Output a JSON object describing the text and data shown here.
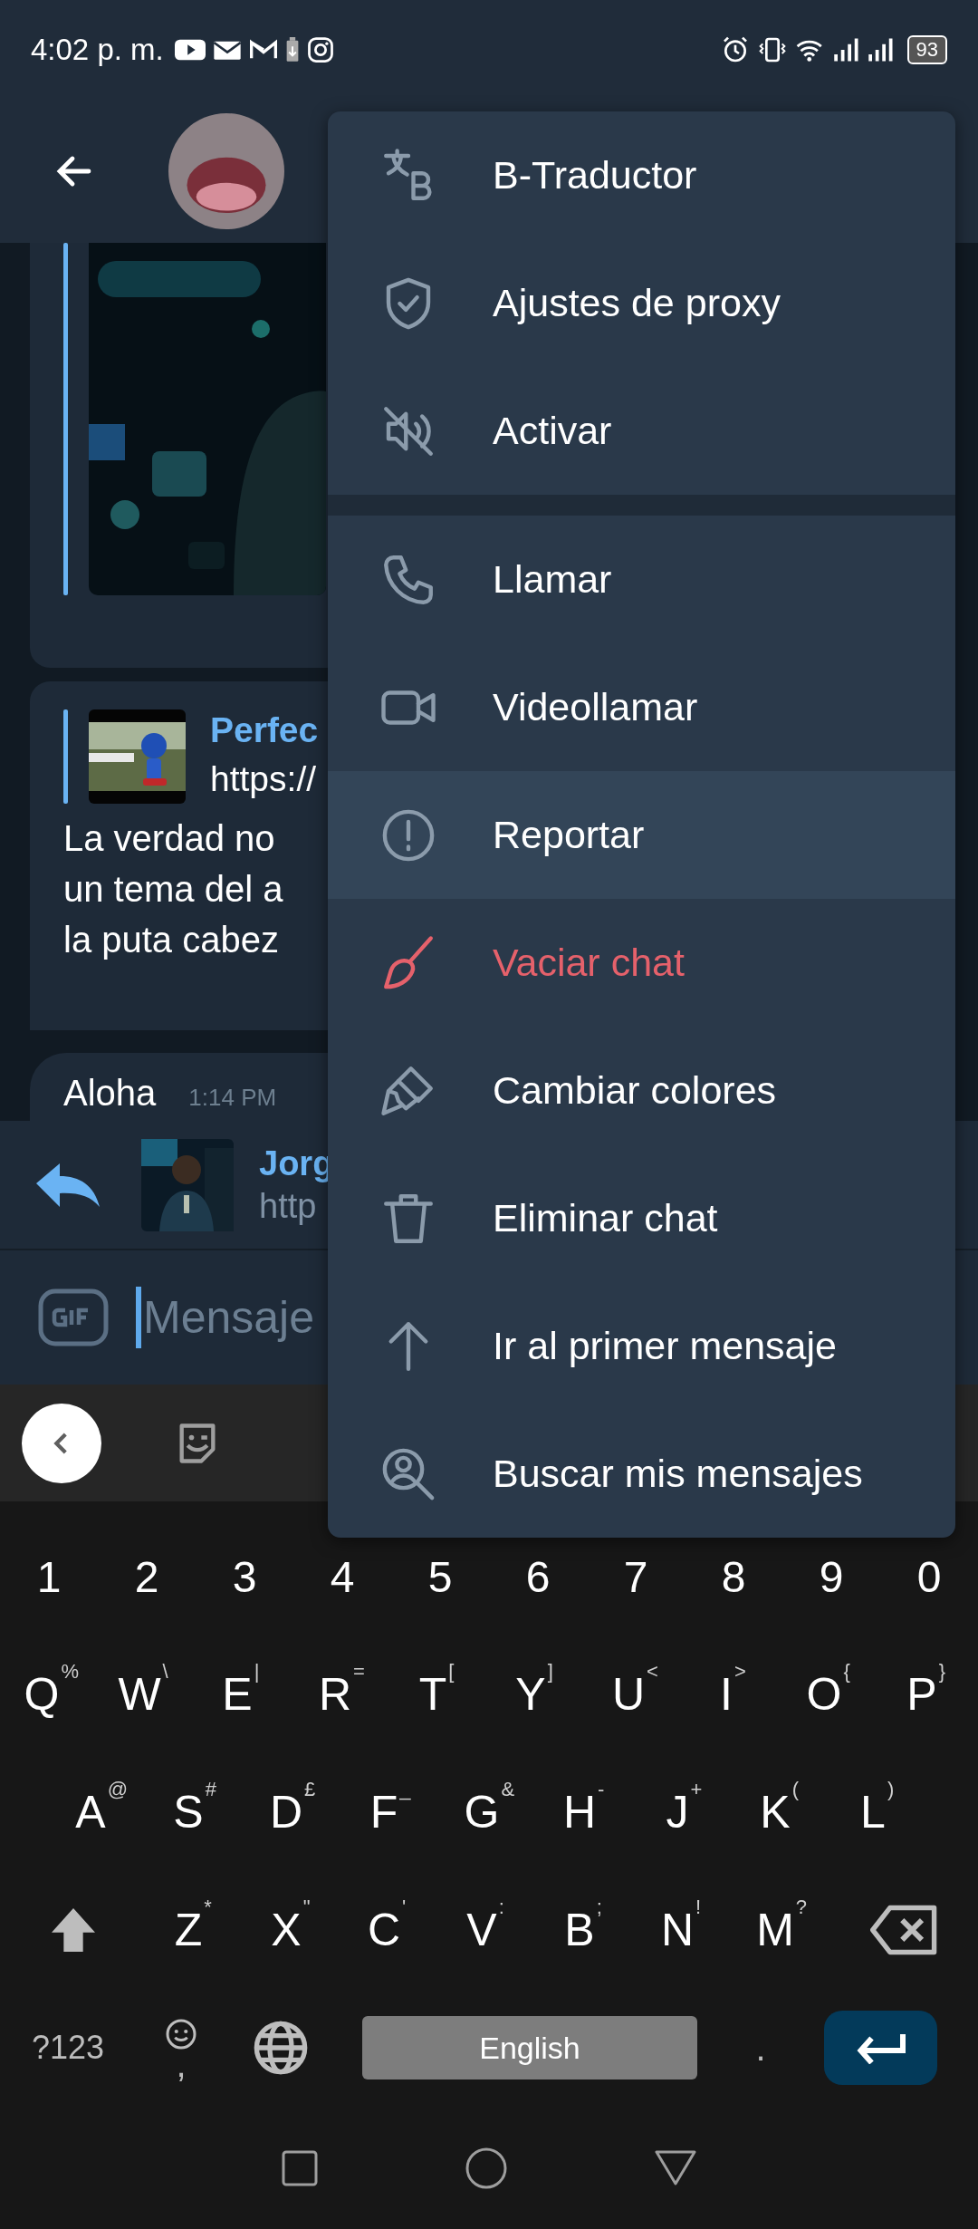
{
  "status_bar": {
    "time": "4:02 p. m.",
    "battery": "93"
  },
  "messages": [
    {
      "kind": "video"
    },
    {
      "kind": "link",
      "link_title": "Perfec",
      "link_url": "https://",
      "lines": [
        "La verdad no",
        "un tema del a",
        "la puta cabez"
      ]
    },
    {
      "kind": "text",
      "text": "Aloha",
      "time": "1:14 PM"
    }
  ],
  "reply_bar": {
    "name": "Jorg",
    "preview": "http"
  },
  "composer": {
    "placeholder": "Mensaje"
  },
  "keyboard": {
    "number_row": [
      "1",
      "2",
      "3",
      "4",
      "5",
      "6",
      "7",
      "8",
      "9",
      "0"
    ],
    "letter_rows": [
      [
        {
          "key": "Q",
          "hint": "%"
        },
        {
          "key": "W",
          "hint": "\\"
        },
        {
          "key": "E",
          "hint": "|"
        },
        {
          "key": "R",
          "hint": "="
        },
        {
          "key": "T",
          "hint": "["
        },
        {
          "key": "Y",
          "hint": "]"
        },
        {
          "key": "U",
          "hint": "<"
        },
        {
          "key": "I",
          "hint": ">"
        },
        {
          "key": "O",
          "hint": "{"
        },
        {
          "key": "P",
          "hint": "}"
        }
      ],
      [
        {
          "key": "A",
          "hint": "@"
        },
        {
          "key": "S",
          "hint": "#"
        },
        {
          "key": "D",
          "hint": "£"
        },
        {
          "key": "F",
          "hint": "_"
        },
        {
          "key": "G",
          "hint": "&"
        },
        {
          "key": "H",
          "hint": "-"
        },
        {
          "key": "J",
          "hint": "+"
        },
        {
          "key": "K",
          "hint": "("
        },
        {
          "key": "L",
          "hint": ")"
        }
      ],
      [
        {
          "key": "Z",
          "hint": "*"
        },
        {
          "key": "X",
          "hint": "\""
        },
        {
          "key": "C",
          "hint": "'"
        },
        {
          "key": "V",
          "hint": ":"
        },
        {
          "key": "B",
          "hint": ";"
        },
        {
          "key": "N",
          "hint": "!"
        },
        {
          "key": "M",
          "hint": "?"
        }
      ]
    ],
    "symbols_key": "?123",
    "comma_key": ",",
    "space_key": "English",
    "period_key": "."
  },
  "menu": {
    "groups": [
      [
        {
          "label": "B-Traductor",
          "selected": false,
          "destructive": false
        },
        {
          "label": "Ajustes de proxy",
          "selected": false,
          "destructive": false
        },
        {
          "label": "Activar",
          "selected": false,
          "destructive": false
        }
      ],
      [
        {
          "label": "Llamar",
          "selected": false,
          "destructive": false
        },
        {
          "label": "Videollamar",
          "selected": false,
          "destructive": false
        },
        {
          "label": "Reportar",
          "selected": true,
          "destructive": false
        },
        {
          "label": "Vaciar chat",
          "selected": false,
          "destructive": true
        },
        {
          "label": "Cambiar colores",
          "selected": false,
          "destructive": false
        },
        {
          "label": "Eliminar chat",
          "selected": false,
          "destructive": false
        },
        {
          "label": "Ir al primer mensaje",
          "selected": false,
          "destructive": false
        },
        {
          "label": "Buscar mis mensajes",
          "selected": false,
          "destructive": false
        }
      ]
    ]
  }
}
